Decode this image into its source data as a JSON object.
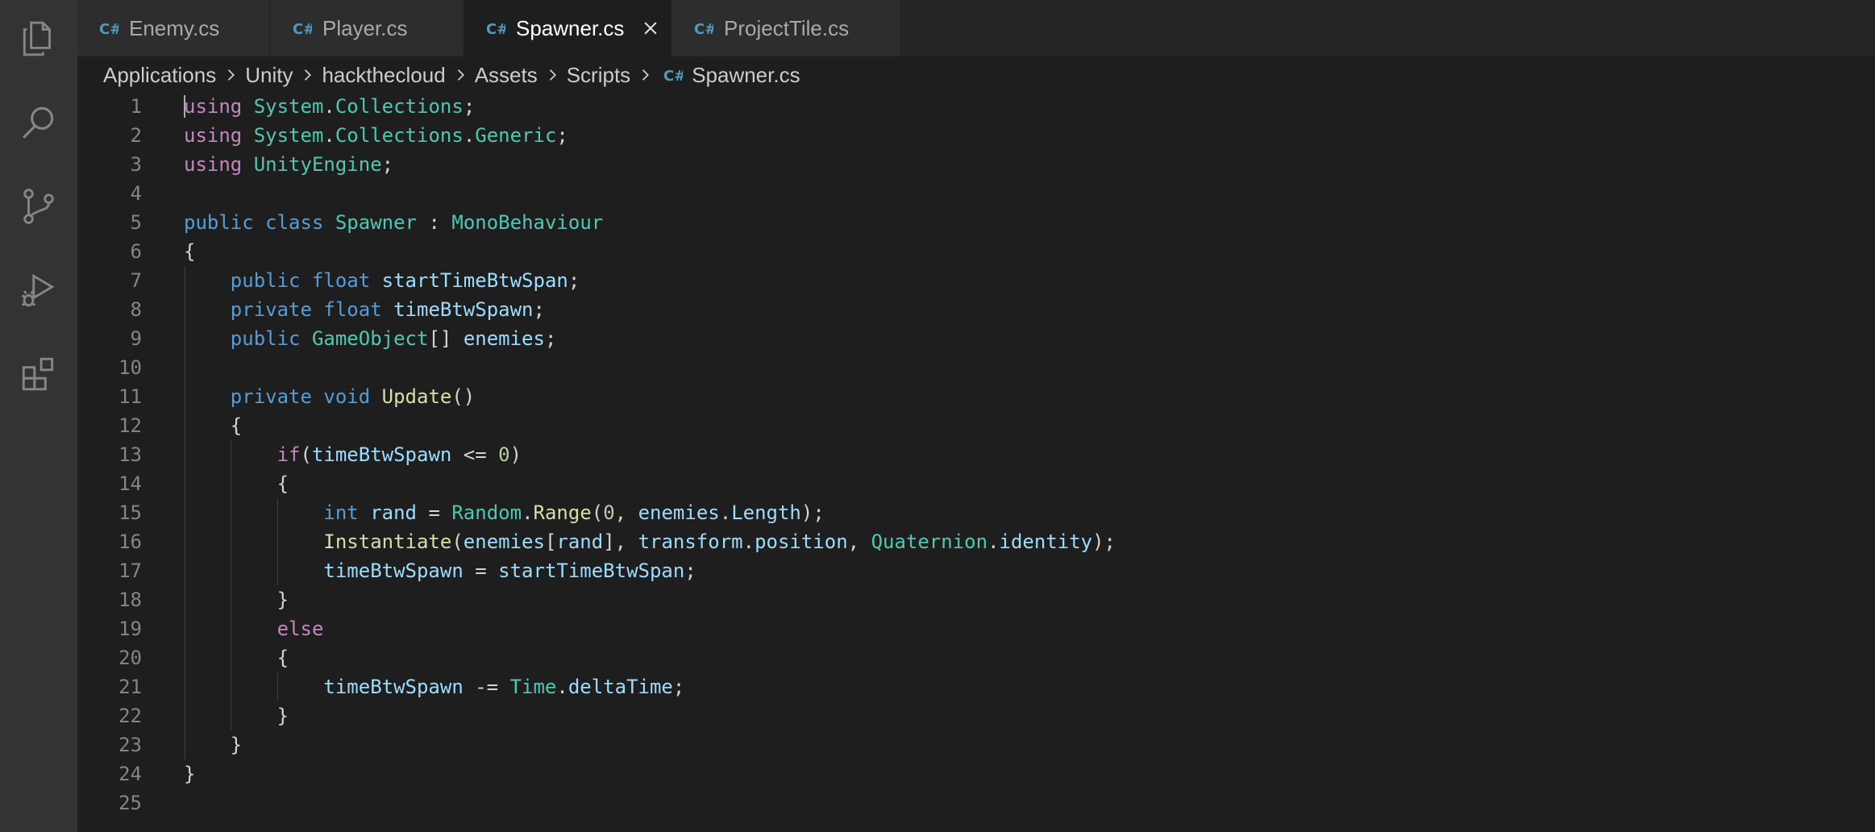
{
  "tabs": [
    {
      "label": "Enemy.cs",
      "active": false
    },
    {
      "label": "Player.cs",
      "active": false
    },
    {
      "label": "Spawner.cs",
      "active": true
    },
    {
      "label": "ProjectTile.cs",
      "active": false
    }
  ],
  "breadcrumb": [
    "Applications",
    "Unity",
    "hackthecloud",
    "Assets",
    "Scripts",
    "Spawner.cs"
  ],
  "line_numbers": [
    "1",
    "2",
    "3",
    "4",
    "5",
    "6",
    "7",
    "8",
    "9",
    "10",
    "11",
    "12",
    "13",
    "14",
    "15",
    "16",
    "17",
    "18",
    "19",
    "20",
    "21",
    "22",
    "23",
    "24",
    "25"
  ],
  "code": {
    "l1": [
      [
        "kw-ctrl",
        "using"
      ],
      [
        "punc",
        " "
      ],
      [
        "type",
        "System"
      ],
      [
        "punc",
        "."
      ],
      [
        "type",
        "Collections"
      ],
      [
        "punc",
        ";"
      ]
    ],
    "l2": [
      [
        "kw-ctrl",
        "using"
      ],
      [
        "punc",
        " "
      ],
      [
        "type",
        "System"
      ],
      [
        "punc",
        "."
      ],
      [
        "type",
        "Collections"
      ],
      [
        "punc",
        "."
      ],
      [
        "type",
        "Generic"
      ],
      [
        "punc",
        ";"
      ]
    ],
    "l3": [
      [
        "kw-ctrl",
        "using"
      ],
      [
        "punc",
        " "
      ],
      [
        "type",
        "UnityEngine"
      ],
      [
        "punc",
        ";"
      ]
    ],
    "l4": [],
    "l5": [
      [
        "kw",
        "public"
      ],
      [
        "punc",
        " "
      ],
      [
        "kw",
        "class"
      ],
      [
        "punc",
        " "
      ],
      [
        "type",
        "Spawner"
      ],
      [
        "punc",
        " : "
      ],
      [
        "type",
        "MonoBehaviour"
      ]
    ],
    "l6": [
      [
        "punc",
        "{"
      ]
    ],
    "l7": [
      [
        "punc",
        "    "
      ],
      [
        "kw",
        "public"
      ],
      [
        "punc",
        " "
      ],
      [
        "kw",
        "float"
      ],
      [
        "punc",
        " "
      ],
      [
        "var",
        "startTimeBtwSpan"
      ],
      [
        "punc",
        ";"
      ]
    ],
    "l8": [
      [
        "punc",
        "    "
      ],
      [
        "kw",
        "private"
      ],
      [
        "punc",
        " "
      ],
      [
        "kw",
        "float"
      ],
      [
        "punc",
        " "
      ],
      [
        "var",
        "timeBtwSpawn"
      ],
      [
        "punc",
        ";"
      ]
    ],
    "l9": [
      [
        "punc",
        "    "
      ],
      [
        "kw",
        "public"
      ],
      [
        "punc",
        " "
      ],
      [
        "type",
        "GameObject"
      ],
      [
        "punc",
        "[] "
      ],
      [
        "var",
        "enemies"
      ],
      [
        "punc",
        ";"
      ]
    ],
    "l10": [],
    "l11": [
      [
        "punc",
        "    "
      ],
      [
        "kw",
        "private"
      ],
      [
        "punc",
        " "
      ],
      [
        "kw",
        "void"
      ],
      [
        "punc",
        " "
      ],
      [
        "fn",
        "Update"
      ],
      [
        "punc",
        "()"
      ]
    ],
    "l12": [
      [
        "punc",
        "    {"
      ]
    ],
    "l13": [
      [
        "punc",
        "        "
      ],
      [
        "kw-ctrl",
        "if"
      ],
      [
        "punc",
        "("
      ],
      [
        "var",
        "timeBtwSpawn"
      ],
      [
        "punc",
        " <= "
      ],
      [
        "num",
        "0"
      ],
      [
        "punc",
        ")"
      ]
    ],
    "l14": [
      [
        "punc",
        "        {"
      ]
    ],
    "l15": [
      [
        "punc",
        "            "
      ],
      [
        "kw",
        "int"
      ],
      [
        "punc",
        " "
      ],
      [
        "var",
        "rand"
      ],
      [
        "punc",
        " = "
      ],
      [
        "type",
        "Random"
      ],
      [
        "punc",
        "."
      ],
      [
        "fn",
        "Range"
      ],
      [
        "punc",
        "("
      ],
      [
        "num",
        "0"
      ],
      [
        "punc",
        ", "
      ],
      [
        "var",
        "enemies"
      ],
      [
        "punc",
        "."
      ],
      [
        "var",
        "Length"
      ],
      [
        "punc",
        ");"
      ]
    ],
    "l16": [
      [
        "punc",
        "            "
      ],
      [
        "fn",
        "Instantiate"
      ],
      [
        "punc",
        "("
      ],
      [
        "var",
        "enemies"
      ],
      [
        "punc",
        "["
      ],
      [
        "var",
        "rand"
      ],
      [
        "punc",
        "], "
      ],
      [
        "var",
        "transform"
      ],
      [
        "punc",
        "."
      ],
      [
        "var",
        "position"
      ],
      [
        "punc",
        ", "
      ],
      [
        "type",
        "Quaternion"
      ],
      [
        "punc",
        "."
      ],
      [
        "var",
        "identity"
      ],
      [
        "punc",
        ");"
      ]
    ],
    "l17": [
      [
        "punc",
        "            "
      ],
      [
        "var",
        "timeBtwSpawn"
      ],
      [
        "punc",
        " = "
      ],
      [
        "var",
        "startTimeBtwSpan"
      ],
      [
        "punc",
        ";"
      ]
    ],
    "l18": [
      [
        "punc",
        "        }"
      ]
    ],
    "l19": [
      [
        "punc",
        "        "
      ],
      [
        "kw-ctrl",
        "else"
      ]
    ],
    "l20": [
      [
        "punc",
        "        {"
      ]
    ],
    "l21": [
      [
        "punc",
        "            "
      ],
      [
        "var",
        "timeBtwSpawn"
      ],
      [
        "punc",
        " -= "
      ],
      [
        "type",
        "Time"
      ],
      [
        "punc",
        "."
      ],
      [
        "var",
        "deltaTime"
      ],
      [
        "punc",
        ";"
      ]
    ],
    "l22": [
      [
        "punc",
        "        }"
      ]
    ],
    "l23": [
      [
        "punc",
        "    }"
      ]
    ],
    "l24": [
      [
        "punc",
        "}"
      ]
    ],
    "l25": []
  },
  "icons": {
    "activity": [
      "explorer-icon",
      "search-icon",
      "source-control-icon",
      "run-debug-icon",
      "extensions-icon"
    ],
    "tab_file": "csharp-file-icon",
    "tab_close": "close-icon",
    "breadcrumb_sep": "chevron-right-icon"
  },
  "colors": {
    "keyword": "#569cd6",
    "control": "#c586c0",
    "type": "#4ec9b0",
    "function": "#dcdcaa",
    "variable": "#9cdcfe",
    "number": "#b5cea8",
    "csharp_icon": "#519aba"
  }
}
